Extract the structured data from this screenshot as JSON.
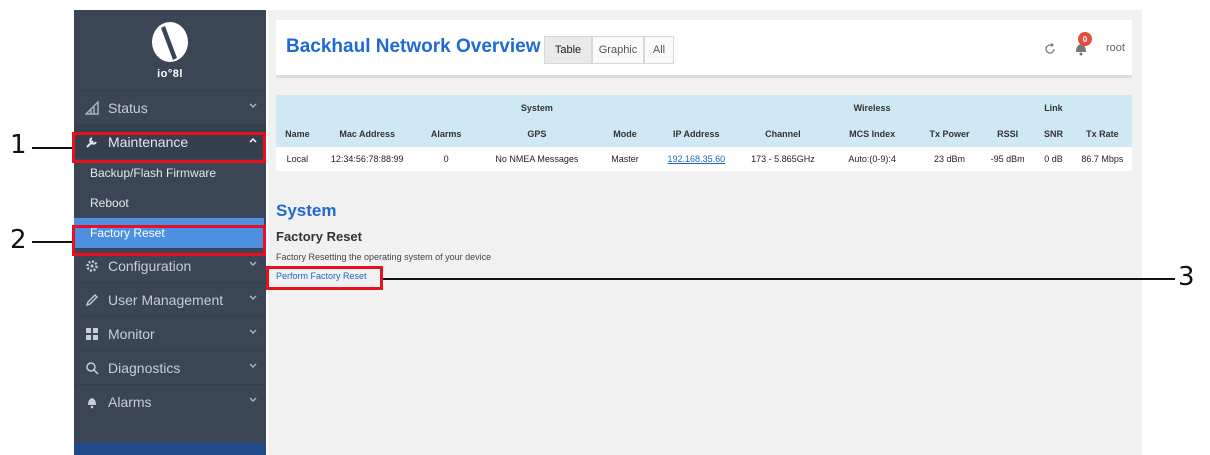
{
  "sidebar": {
    "logo_text": "io°8l",
    "items": [
      {
        "label": "Status",
        "icon": "signal-icon",
        "expanded": false
      },
      {
        "label": "Maintenance",
        "icon": "wrench-icon",
        "expanded": true
      },
      {
        "label": "Configuration",
        "icon": "gear-icon",
        "expanded": false
      },
      {
        "label": "User Management",
        "icon": "pencil-icon",
        "expanded": false
      },
      {
        "label": "Monitor",
        "icon": "dashboard-icon",
        "expanded": false
      },
      {
        "label": "Diagnostics",
        "icon": "search-icon",
        "expanded": false
      },
      {
        "label": "Alarms",
        "icon": "bell-icon",
        "expanded": false
      }
    ],
    "maintenance_sub": [
      {
        "label": "Backup/Flash Firmware",
        "active": false
      },
      {
        "label": "Reboot",
        "active": false
      },
      {
        "label": "Factory Reset",
        "active": true
      }
    ]
  },
  "header": {
    "title": "Backhaul Network Overview",
    "tabs": [
      {
        "label": "Table",
        "active": true
      },
      {
        "label": "Graphic",
        "active": false
      },
      {
        "label": "All",
        "active": false
      }
    ],
    "notification_count": "0",
    "user": "root"
  },
  "table": {
    "groups": {
      "system": "System",
      "wireless": "Wireless",
      "link": "Link"
    },
    "columns": [
      "Name",
      "Mac Address",
      "Alarms",
      "GPS",
      "Mode",
      "IP Address",
      "Channel",
      "MCS Index",
      "Tx Power",
      "RSSI",
      "SNR",
      "Tx Rate"
    ],
    "rows": [
      [
        "Local",
        "12:34:56:78:88:99",
        "0",
        "No NMEA Messages",
        "Master",
        "192.168.35.60",
        "173 - 5.865GHz",
        "Auto:(0-9):4",
        "23 dBm",
        "-95 dBm",
        "0 dB",
        "86.7 Mbps"
      ]
    ]
  },
  "system": {
    "heading": "System",
    "subheading": "Factory Reset",
    "description": "Factory Resetting the operating system of your device",
    "action_link": "Perform Factory Reset"
  },
  "callouts": [
    "1",
    "2",
    "3"
  ],
  "colors": {
    "sidebar_bg": "#3a4655",
    "active_item": "#4d8fe0",
    "title_blue": "#1d6ad3",
    "table_header": "#cfe8f5",
    "callout_red": "#e8101f"
  }
}
